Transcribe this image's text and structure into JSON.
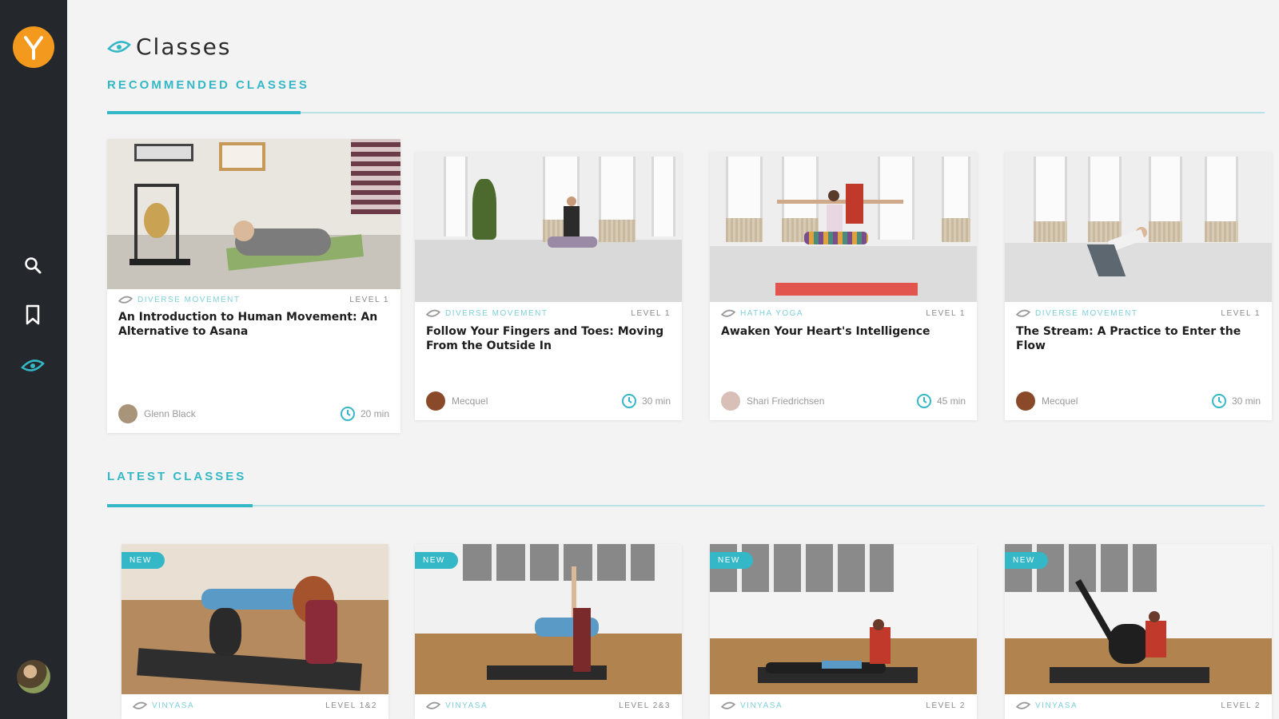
{
  "app": {
    "logo_letter": "Y",
    "brand_color": "#f39a1e",
    "accent_color": "#34b7c6"
  },
  "sidebar": {
    "items": [
      {
        "name": "search",
        "icon": "search-icon"
      },
      {
        "name": "saved",
        "icon": "bookmark-icon"
      },
      {
        "name": "classes",
        "icon": "eye-icon",
        "active": true
      }
    ]
  },
  "page": {
    "title": "Classes"
  },
  "recommended": {
    "heading": "Recommended Classes",
    "cards": [
      {
        "category": "Diverse Movement",
        "level": "Level 1",
        "title": "An Introduction to Human Movement: An Alternative to Asana",
        "teacher": "Glenn Black",
        "duration": "20 min"
      },
      {
        "category": "Diverse Movement",
        "level": "Level 1",
        "title": "Follow Your Fingers and Toes: Moving From the Outside In",
        "teacher": "Mecquel",
        "duration": "30 min"
      },
      {
        "category": "Hatha Yoga",
        "level": "Level 1",
        "title": "Awaken Your Heart's Intelligence",
        "teacher": "Shari Friedrichsen",
        "duration": "45 min"
      },
      {
        "category": "Diverse Movement",
        "level": "Level 1",
        "title": "The Stream: A Practice to Enter the Flow",
        "teacher": "Mecquel",
        "duration": "30 min"
      }
    ]
  },
  "latest": {
    "heading": "Latest Classes",
    "badge": "New",
    "cards": [
      {
        "category": "Vinyasa",
        "level": "Level 1&2"
      },
      {
        "category": "Vinyasa",
        "level": "Level 2&3"
      },
      {
        "category": "Vinyasa",
        "level": "Level 2"
      },
      {
        "category": "Vinyasa",
        "level": "Level 2"
      }
    ]
  }
}
